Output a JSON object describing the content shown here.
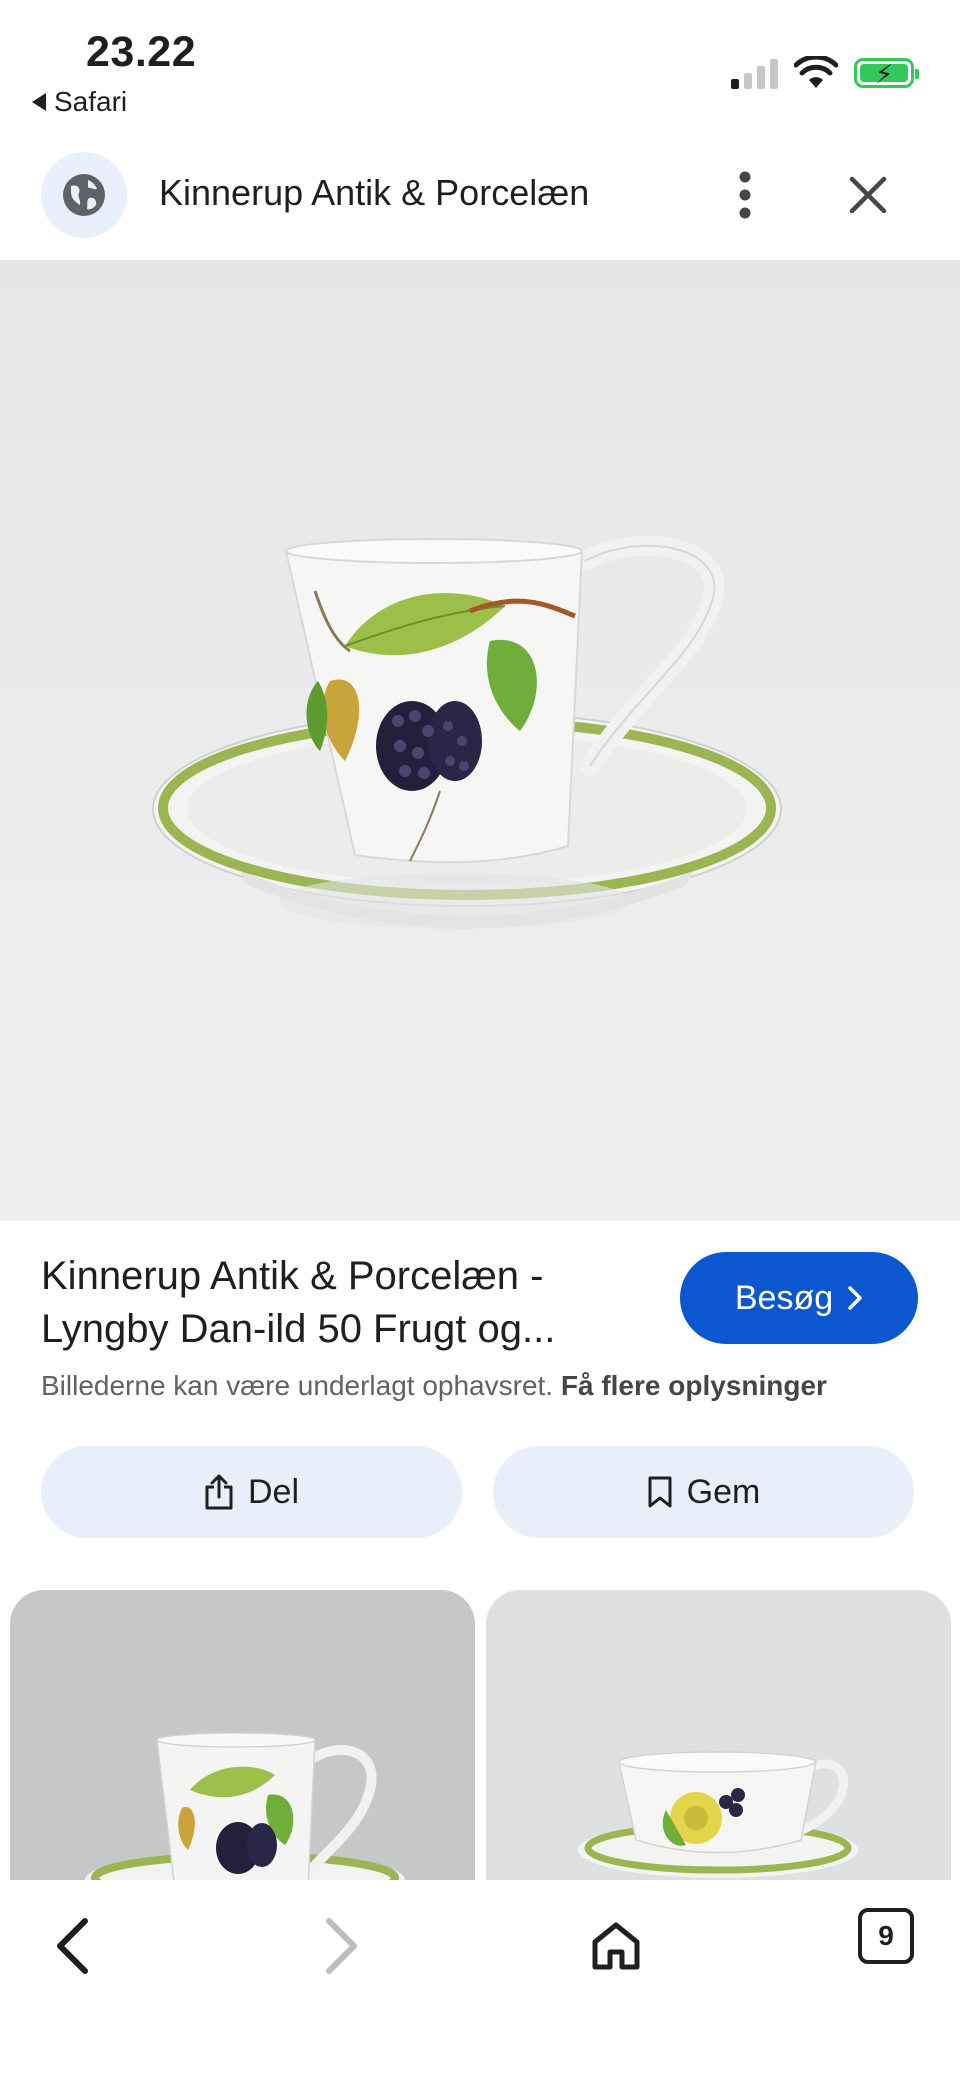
{
  "status_bar": {
    "time": "23.22",
    "back_app": "Safari"
  },
  "top_bar": {
    "site_icon": "globe-icon",
    "title": "Kinnerup Antik & Porcelæn",
    "more_icon": "more-vert-icon",
    "close_icon": "close-icon"
  },
  "result": {
    "title": "Kinnerup Antik & Porcelæn - Lyngby Dan-ild 50 Frugt og...",
    "visit_label": "Besøg",
    "copyright_text": "Billederne kan være underlagt ophavsret.",
    "copyright_link": "Få flere oplysninger"
  },
  "actions": {
    "share_label": "Del",
    "save_label": "Gem"
  },
  "bottom_nav": {
    "tab_count": "9"
  },
  "colors": {
    "accent": "#0b57d0",
    "action_bg": "#e8eefa",
    "battery": "#34c759"
  }
}
